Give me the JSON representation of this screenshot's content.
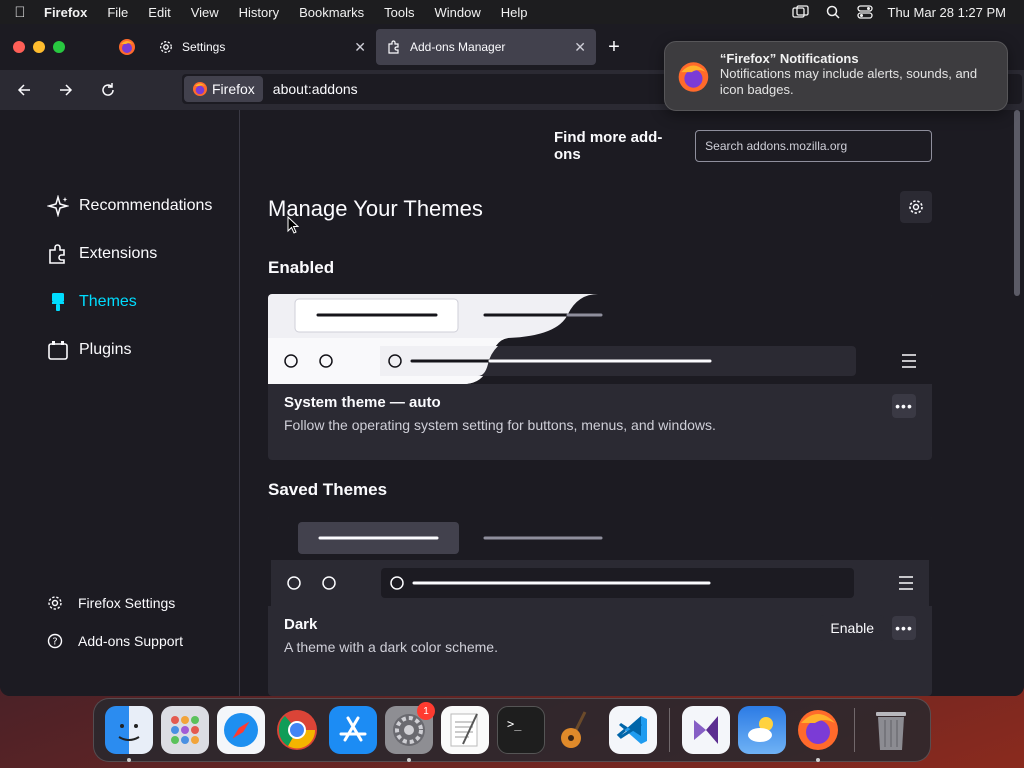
{
  "menubar": {
    "app_name": "Firefox",
    "items": [
      "File",
      "Edit",
      "View",
      "History",
      "Bookmarks",
      "Tools",
      "Window",
      "Help"
    ],
    "clock": "Thu Mar 28  1:27 PM"
  },
  "tabs": [
    {
      "label": "Settings"
    },
    {
      "label": "Add-ons Manager"
    }
  ],
  "navbar": {
    "identity_label": "Firefox",
    "url": "about:addons"
  },
  "notification": {
    "title": "“Firefox” Notifications",
    "body": "Notifications may include alerts, sounds, and icon badges."
  },
  "sidebar": {
    "categories": [
      {
        "label": "Recommendations",
        "icon": "sparkle-icon"
      },
      {
        "label": "Extensions",
        "icon": "puzzle-icon"
      },
      {
        "label": "Themes",
        "icon": "brush-icon",
        "selected": true
      },
      {
        "label": "Plugins",
        "icon": "plugin-icon"
      }
    ],
    "footer": [
      {
        "label": "Firefox Settings",
        "icon": "gear-icon"
      },
      {
        "label": "Add-ons Support",
        "icon": "help-icon"
      }
    ]
  },
  "main": {
    "find_more_label": "Find more add-ons",
    "search_placeholder": "Search addons.mozilla.org",
    "title": "Manage Your Themes",
    "enabled_heading": "Enabled",
    "saved_heading": "Saved Themes",
    "enabled_theme": {
      "name": "System theme — auto",
      "description": "Follow the operating system setting for buttons, menus, and windows."
    },
    "saved_theme": {
      "name": "Dark",
      "description": "A theme with a dark color scheme.",
      "enable_label": "Enable"
    }
  },
  "dock": {
    "apps": [
      "Finder",
      "Launchpad",
      "Safari",
      "Chrome",
      "App Store",
      "System Settings",
      "TextEdit",
      "Terminal",
      "GarageBand",
      "VS Code",
      "Visual Studio",
      "Weather",
      "Firefox",
      "Trash"
    ],
    "settings_badge": "1"
  },
  "colors": {
    "accent": "#00ddff",
    "window_bg": "#1c1b22",
    "card_bg": "#2b2a33"
  }
}
